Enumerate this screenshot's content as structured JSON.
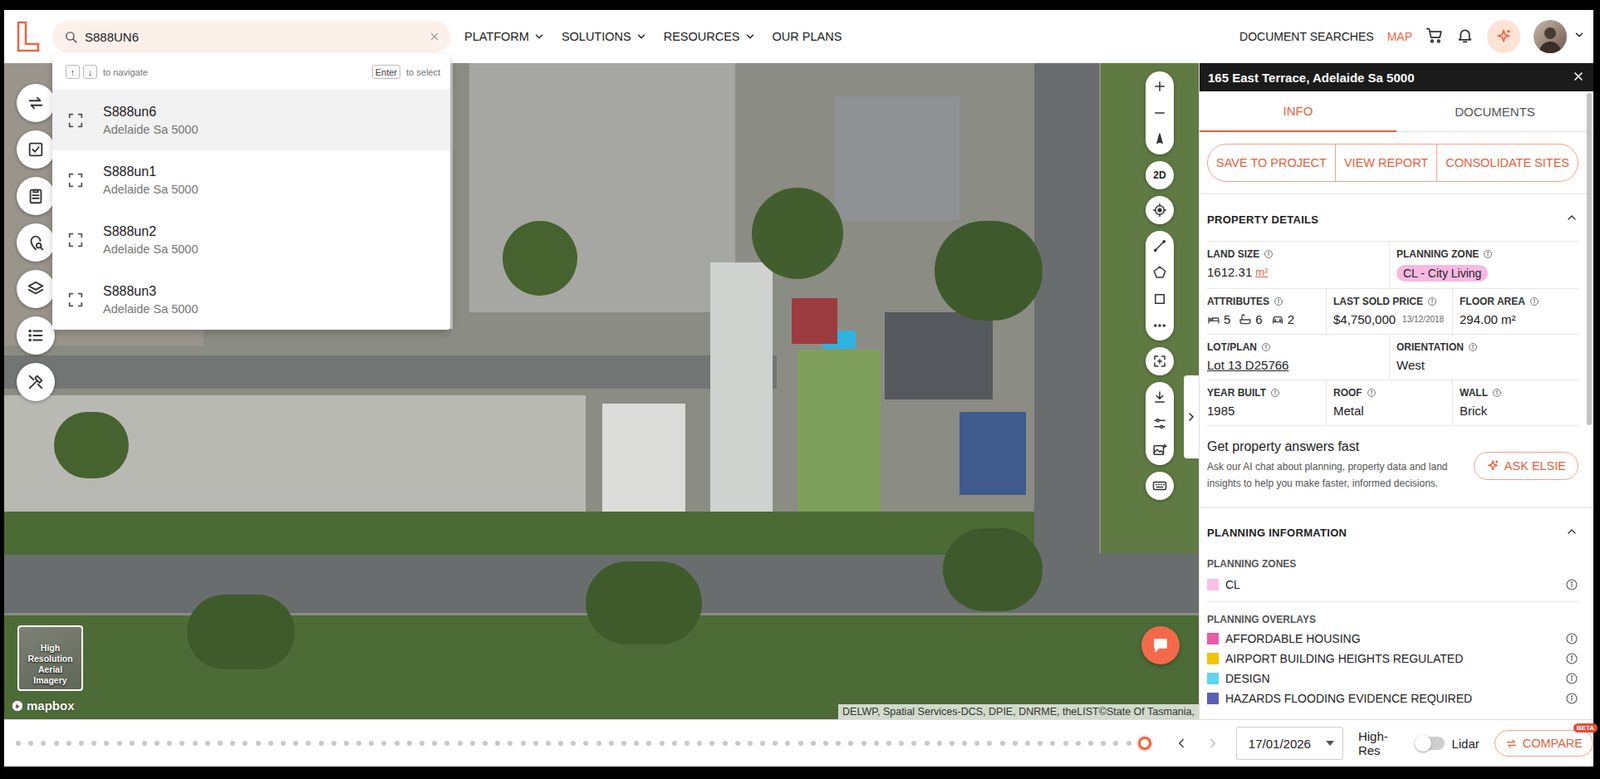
{
  "header": {
    "search": {
      "value": "S888UN6"
    },
    "nav": [
      {
        "label": "PLATFORM",
        "has_menu": true
      },
      {
        "label": "SOLUTIONS",
        "has_menu": true
      },
      {
        "label": "RESOURCES",
        "has_menu": true
      },
      {
        "label": "OUR PLANS",
        "has_menu": false
      }
    ],
    "links": [
      {
        "label": "DOCUMENT SEARCHES",
        "selected": false
      },
      {
        "label": "MAP",
        "selected": true
      }
    ]
  },
  "search_dropdown": {
    "hints": [
      {
        "keys": [
          "↑",
          "↓"
        ],
        "text": "to navigate"
      },
      {
        "keys": [
          "Enter"
        ],
        "text": "to select"
      }
    ],
    "results": [
      {
        "title": "S888un6",
        "subtitle": "Adelaide Sa 5000",
        "selected": true
      },
      {
        "title": "S888un1",
        "subtitle": "Adelaide Sa 5000",
        "selected": false
      },
      {
        "title": "S888un2",
        "subtitle": "Adelaide Sa 5000",
        "selected": false
      },
      {
        "title": "S888un3",
        "subtitle": "Adelaide Sa 5000",
        "selected": false
      }
    ]
  },
  "map": {
    "view_mode": "2D",
    "imagery_label": "High Resolution Aerial Imagery",
    "logo": "mapbox",
    "attribution": "DELWP, Spatial Services-DCS, DPIE, DNRME, theLIST©State Of Tasmania,"
  },
  "timeline": {
    "level": 1,
    "date": "17/01/2026",
    "high_res": {
      "label": "High-Res",
      "on": false
    },
    "lidar": "Lidar",
    "compare": {
      "label": "COMPARE",
      "badge": "BETA"
    }
  },
  "panel": {
    "title": "165 East Terrace, Adelaide Sa 5000",
    "tabs": [
      {
        "label": "INFO",
        "selected": true
      },
      {
        "label": "DOCUMENTS",
        "selected": false
      }
    ],
    "actions": [
      "SAVE TO PROJECT",
      "VIEW REPORT",
      "CONSOLIDATE SITES"
    ],
    "property_details": {
      "title": "PROPERTY DETAILS",
      "expanded": true,
      "rows": [
        [
          {
            "label": "LAND SIZE",
            "kind": "area",
            "value": "1612.31",
            "unit": "m²"
          },
          {
            "label": "PLANNING ZONE",
            "kind": "badge",
            "value": "CL - City Living",
            "color": "#f7b9e3"
          }
        ],
        [
          {
            "label": "ATTRIBUTES",
            "kind": "attributes",
            "beds": "5",
            "baths": "6",
            "cars": "2"
          },
          {
            "label": "LAST SOLD PRICE",
            "kind": "price",
            "value": "$4,750,000",
            "date": "13/12/2018"
          },
          {
            "label": "FLOOR AREA",
            "kind": "text",
            "value": "294.00 m²"
          }
        ],
        [
          {
            "label": "LOT/PLAN",
            "kind": "link",
            "value": "Lot 13 D25766"
          },
          {
            "label": "ORIENTATION",
            "kind": "text",
            "value": "West"
          }
        ],
        [
          {
            "label": "YEAR BUILT",
            "kind": "text",
            "value": "1985"
          },
          {
            "label": "ROOF",
            "kind": "text",
            "value": "Metal"
          },
          {
            "label": "WALL",
            "kind": "text",
            "value": "Brick"
          }
        ]
      ]
    },
    "ask": {
      "title": "Get property answers fast",
      "text": "Ask our AI chat about planning, property data and land insights to help you make faster, informed decisions.",
      "button": "ASK ELSIE"
    },
    "planning": {
      "title": "PLANNING INFORMATION",
      "expanded": true,
      "zones_title": "PLANNING ZONES",
      "zones": [
        {
          "label": "CL",
          "color": "#f9c0e4"
        }
      ],
      "overlays_title": "PLANNING OVERLAYS",
      "overlays": [
        {
          "label": "AFFORDABLE HOUSING",
          "color": "#ea5aa9"
        },
        {
          "label": "AIRPORT BUILDING HEIGHTS REGULATED",
          "color": "#f2c400"
        },
        {
          "label": "DESIGN",
          "color": "#5fd3f0"
        },
        {
          "label": "HAZARDS FLOODING EVIDENCE REQUIRED",
          "color": "#5a60b4"
        }
      ]
    }
  }
}
